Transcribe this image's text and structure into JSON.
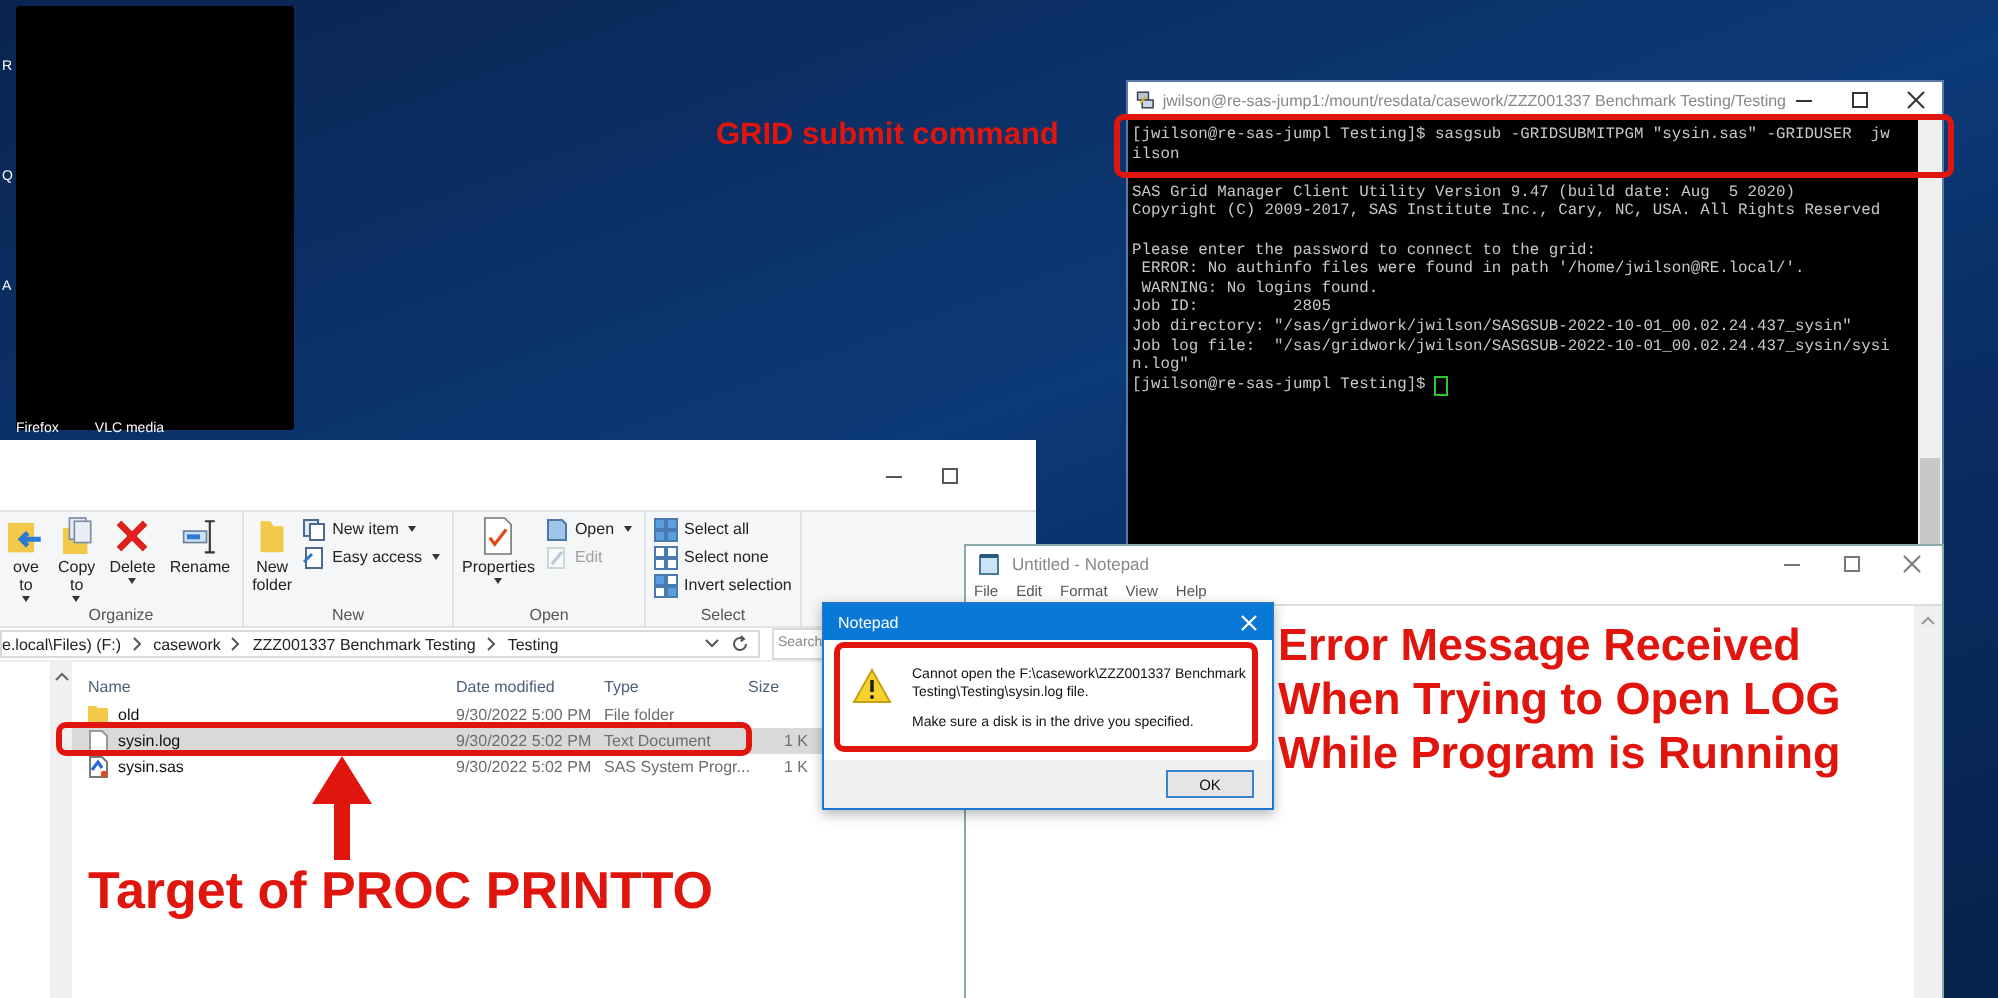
{
  "desktop": {
    "edge_letters": [
      "R",
      "Q",
      "A"
    ],
    "icon_labels": [
      "Firefox",
      "VLC media"
    ]
  },
  "terminal": {
    "title": "jwilson@re-sas-jump1:/mount/resdata/casework/ZZZ001337 Benchmark Testing/Testing",
    "lines": [
      {
        "kind": "text",
        "text": "[jwilson@re-sas-jumpl Testing]$ sasgsub -GRIDSUBMITPGM \"sysin.sas\" -GRIDUSER  jw"
      },
      {
        "kind": "text",
        "text": "ilson"
      },
      {
        "kind": "blank"
      },
      {
        "kind": "text",
        "text": "SAS Grid Manager Client Utility Version 9.47 (build date: Aug  5 2020)"
      },
      {
        "kind": "text",
        "text": "Copyright (C) 2009-2017, SAS Institute Inc., Cary, NC, USA. All Rights Reserved"
      },
      {
        "kind": "blank"
      },
      {
        "kind": "text",
        "text": "Please enter the password to connect to the grid:"
      },
      {
        "kind": "text",
        "text": " ERROR: No authinfo files were found in path '/home/jwilson@RE.local/'."
      },
      {
        "kind": "text",
        "text": " WARNING: No logins found."
      },
      {
        "kind": "text",
        "text": "Job ID:          2805"
      },
      {
        "kind": "text",
        "text": "Job directory: \"/sas/gridwork/jwilson/SASGSUB-2022-10-01_00.02.24.437_sysin\""
      },
      {
        "kind": "text",
        "text": "Job log file:  \"/sas/gridwork/jwilson/SASGSUB-2022-10-01_00.02.24.437_sysin/sysi"
      },
      {
        "kind": "text",
        "text": "n.log\""
      },
      {
        "kind": "text",
        "text": "[jwilson@re-sas-jumpl Testing]$"
      }
    ],
    "cursor": true
  },
  "explorer": {
    "ribbon": [
      {
        "label": "Organize",
        "large": [
          {
            "lines": [
              "ove",
              "to"
            ],
            "dropdown": true
          },
          {
            "lines": [
              "Copy",
              "to"
            ],
            "dropdown": true
          },
          {
            "lines": [
              "Delete"
            ],
            "dropdown": true
          },
          {
            "lines": [
              "Rename"
            ],
            "dropdown": false
          }
        ]
      },
      {
        "label": "New",
        "large": [
          {
            "lines": [
              "New",
              "folder"
            ],
            "dropdown": false
          }
        ],
        "small": [
          {
            "label": "New item",
            "dropdown": true,
            "disabled": false
          },
          {
            "label": "Easy access",
            "dropdown": true,
            "disabled": false
          }
        ]
      },
      {
        "label": "Open",
        "large": [
          {
            "lines": [
              "Properties"
            ],
            "dropdown": true
          }
        ],
        "small": [
          {
            "label": "Open",
            "dropdown": true,
            "disabled": false
          },
          {
            "label": "Edit",
            "dropdown": false,
            "disabled": true
          }
        ]
      },
      {
        "label": "Select",
        "small": [
          {
            "label": "Select all",
            "dropdown": false,
            "disabled": false
          },
          {
            "label": "Select none",
            "dropdown": false,
            "disabled": false
          },
          {
            "label": "Invert selection",
            "dropdown": false,
            "disabled": false
          }
        ]
      }
    ],
    "path": [
      "e.local\\Files) (F:)",
      "casework",
      "ZZZ001337 Benchmark Testing",
      "Testing"
    ],
    "search": {
      "placeholder": "Search"
    },
    "columns": [
      "Name",
      "Date modified",
      "Type",
      "Size"
    ],
    "rows": [
      {
        "kind": "folder",
        "name": "old",
        "date": "9/30/2022 5:00 PM",
        "type": "File folder",
        "selected": false
      },
      {
        "kind": "text",
        "name": "sysin.log",
        "date": "9/30/2022 5:02 PM",
        "type": "Text Document",
        "size": "1 K",
        "selected": true
      },
      {
        "kind": "program",
        "name": "sysin.sas",
        "date": "9/30/2022 5:02 PM",
        "type": "SAS System Progr...",
        "size": "1 K",
        "selected": false
      }
    ]
  },
  "notepad": {
    "title": "Untitled - Notepad",
    "menu": [
      "File",
      "Edit",
      "Format",
      "View",
      "Help"
    ]
  },
  "dialog": {
    "title": "Notepad",
    "message": "Cannot open the F:\\casework\\ZZZ001337 Benchmark Testing\\Testing\\sysin.log file.",
    "detail": "Make sure a disk is in the drive you specified.",
    "button": "OK"
  },
  "annotations": {
    "grid_label": "GRID submit command",
    "target_label": "Target of PROC PRINTTO",
    "error_label": [
      "Error Message Received",
      "When Trying to Open LOG",
      "While Program is Running"
    ]
  }
}
